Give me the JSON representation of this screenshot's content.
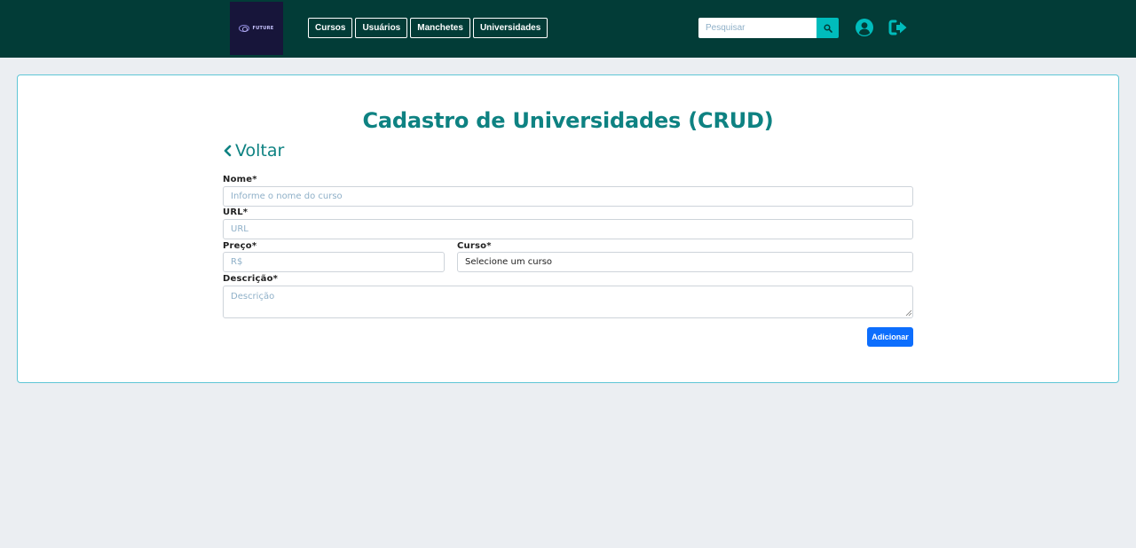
{
  "header": {
    "logo_text": "FUTURE",
    "nav": [
      {
        "label": "Cursos"
      },
      {
        "label": "Usuários"
      },
      {
        "label": "Manchetes"
      },
      {
        "label": "Universidades"
      }
    ],
    "search": {
      "placeholder": "Pesquisar",
      "value": ""
    },
    "icons": {
      "search": "search-icon",
      "user": "user-circle-icon",
      "logout": "sign-out-icon"
    },
    "colors": {
      "navbar": "#023c37",
      "search_button": "#00bcbc",
      "icon": "#00bcbc"
    }
  },
  "main": {
    "title": "Cadastro de Universidades (CRUD)",
    "back_label": "Voltar",
    "form": {
      "nome": {
        "label": "Nome*",
        "placeholder": "Informe o nome do curso",
        "value": ""
      },
      "url": {
        "label": "URL*",
        "placeholder": "URL",
        "value": ""
      },
      "preco": {
        "label": "Preço*",
        "placeholder": "R$",
        "value": ""
      },
      "curso": {
        "label": "Curso*",
        "selected": "Selecione um curso"
      },
      "descricao": {
        "label": "Descrição*",
        "placeholder": "Descrição",
        "value": ""
      },
      "submit_label": "Adicionar"
    },
    "colors": {
      "title": "#0e8282",
      "submit": "#0d6efd",
      "card_border": "#5fc6d6",
      "background": "#ebeef2"
    }
  }
}
